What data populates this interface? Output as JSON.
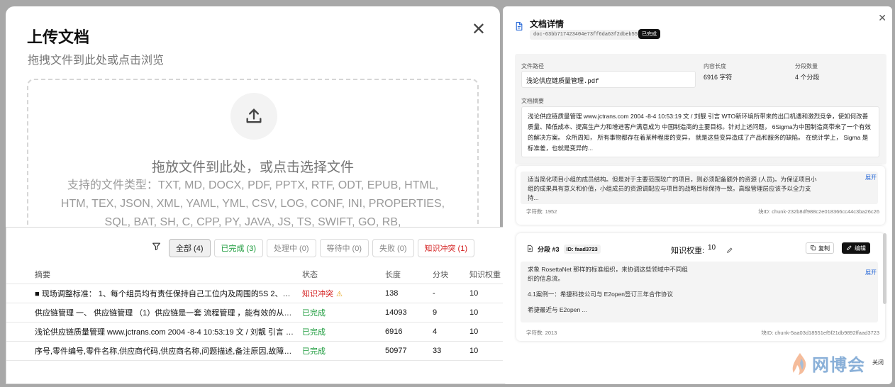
{
  "upload": {
    "title": "上传文档",
    "subtitle": "拖拽文件到此处或点击浏览",
    "drop_text": "拖放文件到此处，或点击选择文件",
    "supported_types": "支持的文件类型：TXT, MD, DOCX, PDF, PPTX, RTF, ODT, EPUB, HTML, HTM, TEX, JSON, XML, YAML, YML, CSV, LOG, CONF, INI, PROPERTIES, SQL, BAT, SH, C, CPP, PY, JAVA, JS, TS, SWIFT, GO, RB,"
  },
  "filters": [
    {
      "label": "全部 (4)",
      "style": "active"
    },
    {
      "label": "已完成 (3)",
      "style": "green"
    },
    {
      "label": "处理中 (0)",
      "style": ""
    },
    {
      "label": "等待中 (0)",
      "style": ""
    },
    {
      "label": "失败 (0)",
      "style": ""
    },
    {
      "label": "知识冲突 (1)",
      "style": "red"
    }
  ],
  "table": {
    "headers": {
      "summary": "摘要",
      "status": "状态",
      "length": "长度",
      "chunks": "分块",
      "weight": "知识权重"
    },
    "rows": [
      {
        "summary": "■ 现场调整标准：  1、每个组员均有责任保持自己工位内及周围的5S 2、物料架...",
        "status": "知识冲突",
        "status_type": "bad",
        "length": "138",
        "chunks": "-",
        "weight": "10"
      },
      {
        "summary": "供应链管理 一、 供应链管理 （1）供应链是一套 流程管理 ，能有效的从材料...",
        "status": "已完成",
        "status_type": "ok",
        "length": "14093",
        "chunks": "9",
        "weight": "10"
      },
      {
        "summary": "浅论供应链质量管理 www.jctrans.com 2004 -8-4 10:53:19 文 / 刘靓 引言 W...",
        "status": "已完成",
        "status_type": "ok",
        "length": "6916",
        "chunks": "4",
        "weight": "10"
      },
      {
        "summary": "序号,零件编号,零件名称,供应商代码,供应商名称,问题描述,备注原因,故障类别,故...",
        "status": "已完成",
        "status_type": "ok",
        "length": "50977",
        "chunks": "33",
        "weight": "10"
      }
    ]
  },
  "detail": {
    "title": "文档详情",
    "doc_id": "doc-63bb717423404e73ff6da63f2dbeb555",
    "badge": "已完成",
    "path_label": "文件路径",
    "path_value": "浅论供应链质量管理.pdf",
    "length_label": "内容长度",
    "length_value": "6916 字符",
    "chunks_label": "分段数量",
    "chunks_value": "4 个分段",
    "summary_label": "文档摘要",
    "summary_text": "浅论供应链质量管理 www.jctrans.com 2004 -8-4 10:53:19 文 / 刘靓 引言 WTO新环境所带来的出口机遇和激烈竞争，使如何改善质量、降低成本、提高生产力和增进客户满意成为 中国制造商的主要目标。针对上述问题， 6Sigma为中国制造商带来了一个有效的解决方案。 众所周知， 所有事物都存在着某种程度的变异， 就是这些变异造成了产品和服务的缺陷。 在统计学上， Sigma 是标准差，也就是变异的...",
    "chunk_a": {
      "text": "适当简化项目小组的成员结构。但是对于主要范围较广的项目，则必须配备额外的资源 (人员)。为保证项目小组的成果具有意义和价值，小组成员的资源调配应与项目的战略目标保持一致。高级管理层应该予以全力支持...",
      "expand": "展开",
      "chars": "字符数: 1952",
      "chunk_id": "块ID: chunk-232b8df988c2e018366cc44c3ba26c26"
    },
    "chunk_b": {
      "title": "分段 #3",
      "id_badge": "ID: faad3723",
      "weight_label": "知识权重:",
      "weight_value": "10",
      "copy": "复制",
      "edit": "编辑",
      "line1": "求象 RosettaNet 那样的标准组织，来协调这些领域中不同组织的信息流。",
      "line2": "4.1案例一：希捷科技公司与 E2open签订三年合作协议",
      "line3": "希捷最近与 E2open ...",
      "expand": "展开",
      "chars": "字符数: 2013",
      "chunk_id": "块ID: chunk-5aa03d18551ef5f21db9892ffaad3723"
    },
    "close_label": "关闭"
  },
  "watermark": "网博会",
  "colors": {
    "success": "#1a9a3a",
    "danger": "#d42020",
    "link": "#2a6ad8"
  }
}
